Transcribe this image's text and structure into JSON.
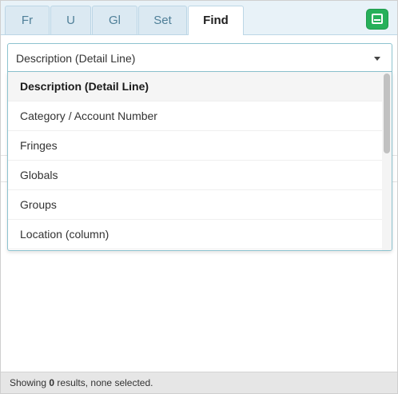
{
  "tabs": [
    {
      "label": "Fr"
    },
    {
      "label": "U"
    },
    {
      "label": "Gl"
    },
    {
      "label": "Set"
    },
    {
      "label": "Find",
      "active": true
    }
  ],
  "toolbar": {
    "toggle_icon": "panel-toggle-icon",
    "accent": "#27b05a"
  },
  "search_field": {
    "selected": "Description (Detail Line)",
    "options": [
      {
        "label": "Description (Detail Line)",
        "selected": true
      },
      {
        "label": "Category / Account Number"
      },
      {
        "label": "Fringes"
      },
      {
        "label": "Globals"
      },
      {
        "label": "Groups"
      },
      {
        "label": "Location (column)"
      }
    ]
  },
  "status": {
    "prefix": "Showing ",
    "count": "0",
    "suffix": " results, none selected."
  }
}
